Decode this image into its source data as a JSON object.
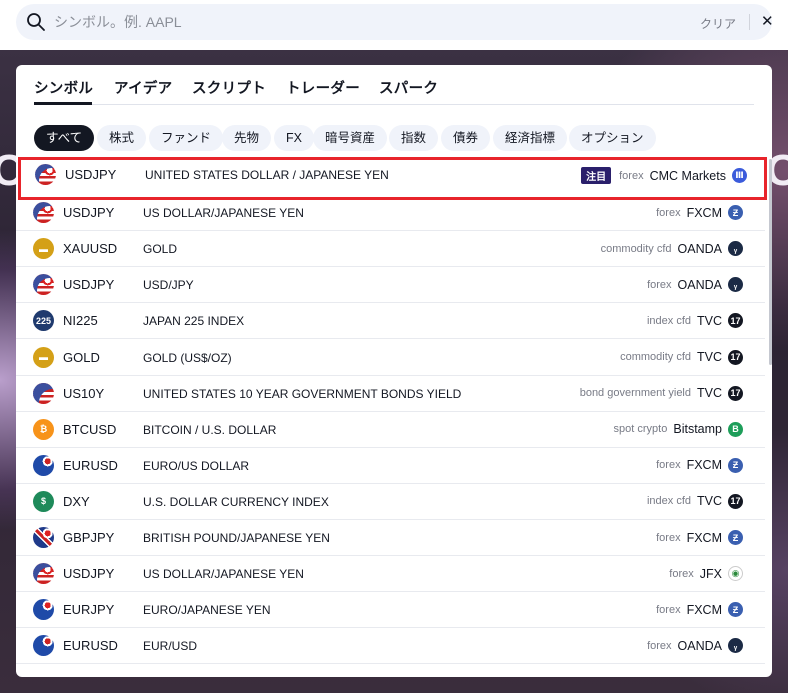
{
  "search": {
    "placeholder": "シンボル。例. AAPL",
    "value": "",
    "clear_label": "クリア"
  },
  "tabs": [
    {
      "label": "シンボル",
      "active": true
    },
    {
      "label": "アイデア"
    },
    {
      "label": "スクリプト"
    },
    {
      "label": "トレーダー"
    },
    {
      "label": "スパーク"
    }
  ],
  "filters": [
    {
      "label": "すべて",
      "active": true
    },
    {
      "label": "株式"
    },
    {
      "label": "ファンド"
    },
    {
      "label": "先物"
    },
    {
      "label": "FX"
    },
    {
      "label": "暗号資産"
    },
    {
      "label": "指数"
    },
    {
      "label": "債券"
    },
    {
      "label": "経済指標"
    },
    {
      "label": "オプション"
    }
  ],
  "results": [
    {
      "symbol": "USDJPY",
      "description": "UNITED STATES DOLLAR / JAPANESE YEN",
      "badge": "注目",
      "type": "forex",
      "exchange": "CMC Markets",
      "icon": "us-jp-flag-icon",
      "exchange_icon": "cmc-markets-logo-icon",
      "exchange_color": "#3b5bdb"
    },
    {
      "symbol": "USDJPY",
      "description": "US DOLLAR/JAPANESE YEN",
      "type": "forex",
      "exchange": "FXCM",
      "icon": "us-jp-flag-icon",
      "exchange_icon": "fxcm-logo-icon",
      "exchange_color": "#3a5fb0"
    },
    {
      "symbol": "XAUUSD",
      "description": "GOLD",
      "type": "commodity cfd",
      "exchange": "OANDA",
      "icon": "gold-bars-icon",
      "exchange_icon": "oanda-logo-icon",
      "exchange_color": "#1b2a45"
    },
    {
      "symbol": "USDJPY",
      "description": "USD/JPY",
      "type": "forex",
      "exchange": "OANDA",
      "icon": "us-jp-flag-icon",
      "exchange_icon": "oanda-logo-icon",
      "exchange_color": "#1b2a45"
    },
    {
      "symbol": "NI225",
      "description": "JAPAN 225 INDEX",
      "type": "index cfd",
      "exchange": "TVC",
      "icon": "ni225-icon",
      "icon_text": "225",
      "exchange_icon": "tvc-logo-icon",
      "exchange_color": "#131722"
    },
    {
      "symbol": "GOLD",
      "description": "GOLD (US$/OZ)",
      "type": "commodity cfd",
      "exchange": "TVC",
      "icon": "gold-bars-icon",
      "exchange_icon": "tvc-logo-icon",
      "exchange_color": "#131722"
    },
    {
      "symbol": "US10Y",
      "description": "UNITED STATES 10 YEAR GOVERNMENT BONDS YIELD",
      "type": "bond government yield",
      "exchange": "TVC",
      "icon": "us-flag-icon",
      "exchange_icon": "tvc-logo-icon",
      "exchange_color": "#131722"
    },
    {
      "symbol": "BTCUSD",
      "description": "BITCOIN / U.S. DOLLAR",
      "type": "spot crypto",
      "exchange": "Bitstamp",
      "icon": "bitcoin-icon",
      "exchange_icon": "bitstamp-logo-icon",
      "exchange_color": "#1e9e5a"
    },
    {
      "symbol": "EURUSD",
      "description": "EURO/US DOLLAR",
      "type": "forex",
      "exchange": "FXCM",
      "icon": "eu-us-flag-icon",
      "exchange_icon": "fxcm-logo-icon",
      "exchange_color": "#3a5fb0"
    },
    {
      "symbol": "DXY",
      "description": "U.S. DOLLAR CURRENCY INDEX",
      "type": "index cfd",
      "exchange": "TVC",
      "icon": "dollar-icon",
      "exchange_icon": "tvc-logo-icon",
      "exchange_color": "#131722"
    },
    {
      "symbol": "GBPJPY",
      "description": "BRITISH POUND/JAPANESE YEN",
      "type": "forex",
      "exchange": "FXCM",
      "icon": "gb-jp-flag-icon",
      "exchange_icon": "fxcm-logo-icon",
      "exchange_color": "#3a5fb0"
    },
    {
      "symbol": "USDJPY",
      "description": "US DOLLAR/JAPANESE YEN",
      "type": "forex",
      "exchange": "JFX",
      "icon": "us-jp-flag-icon",
      "exchange_icon": "jfx-logo-icon",
      "exchange_color": "#ffffff"
    },
    {
      "symbol": "EURJPY",
      "description": "EURO/JAPANESE YEN",
      "type": "forex",
      "exchange": "FXCM",
      "icon": "eu-jp-flag-icon",
      "exchange_icon": "fxcm-logo-icon",
      "exchange_color": "#3a5fb0"
    },
    {
      "symbol": "EURUSD",
      "description": "EUR/USD",
      "type": "forex",
      "exchange": "OANDA",
      "icon": "eu-us-flag-icon",
      "exchange_icon": "oanda-logo-icon",
      "exchange_color": "#1b2a45"
    }
  ],
  "colors": {
    "highlight_border": "#e8242b",
    "accent": "#131722",
    "badge_bg": "#2a1f6b"
  }
}
